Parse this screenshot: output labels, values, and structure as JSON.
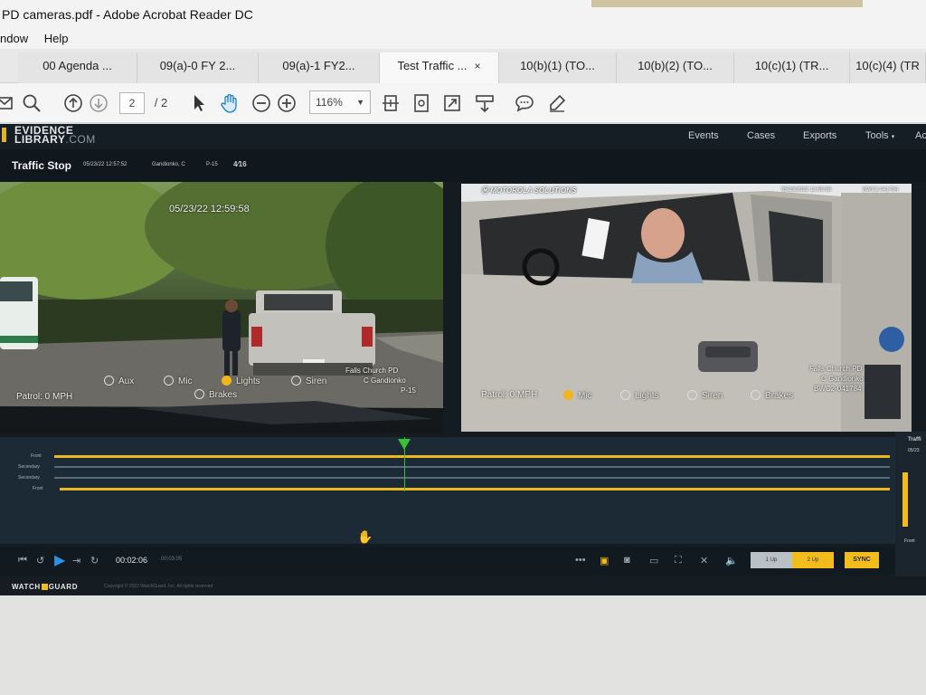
{
  "window": {
    "title": "PD cameras.pdf - Adobe Acrobat Reader DC"
  },
  "menu": {
    "items": [
      "ndow",
      "Help"
    ]
  },
  "tabs": [
    {
      "label": "00 Agenda ..."
    },
    {
      "label": "09(a)-0 FY 2..."
    },
    {
      "label": "09(a)-1 FY2..."
    },
    {
      "label": "Test Traffic ...",
      "close": "×"
    },
    {
      "label": "10(b)(1) (TO..."
    },
    {
      "label": "10(b)(2) (TO..."
    },
    {
      "label": "10(c)(1) (TR..."
    },
    {
      "label": "10(c)(4) (TR"
    }
  ],
  "toolbar": {
    "page_current": "2",
    "page_total": "/ 2",
    "zoom": "116%"
  },
  "app": {
    "logo_line1": "EVIDENCE",
    "logo_line2": "LIBRARY",
    "logo_domain": ".COM",
    "nav": [
      "Events",
      "Cases",
      "Exports",
      "Tools",
      "Ac"
    ],
    "tools_caret": "▾",
    "incident_title": "Traffic Stop",
    "incident_meta": [
      "05/23/22 12:57:52",
      "Gandionko, C",
      "P-15"
    ]
  },
  "video_left": {
    "timestamp": "05/23/22 12:59:58",
    "speed": "Patrol: 0 MPH",
    "indicators": {
      "aux": "Aux",
      "mic": "Mic",
      "lights": "Lights",
      "siren": "Siren",
      "brakes": "Brakes"
    },
    "agency": "Falls Church PD",
    "officer": "C Gandionko",
    "unit": "P-15"
  },
  "video_right": {
    "brand": "MOTOROLA SOLUTIONS",
    "timestamp": "05/23/2022 12:59:58",
    "device": "BWC2-041784",
    "speed": "Patrol: 0 MPH",
    "indicators": {
      "mic": "Mic",
      "lights": "Lights",
      "siren": "Siren",
      "brakes": "Brakes"
    },
    "agency": "Falls Church PD",
    "officer": "C Gandionko",
    "unit": "BWC2-041784"
  },
  "timeline": {
    "tracks": [
      {
        "label": "Front",
        "color": "#e8b81d"
      },
      {
        "label": "Secondary",
        "color": "#5b6d7d"
      },
      {
        "label": "Secondary",
        "color": "#5b6d7d"
      },
      {
        "label": "Front",
        "color": "#e8b81d"
      }
    ]
  },
  "player": {
    "time_current": "00:02:06",
    "time_total": "00:03:05",
    "view_1up": "1 Up",
    "view_2up": "2 Up",
    "sync": "SYNC"
  },
  "side_panel": {
    "label": "Traffi",
    "meta": "05/23",
    "footer": "Front"
  },
  "footer": {
    "brand_a": "WATCH",
    "brand_b": "GUARD",
    "copyright": "Copyright © 2022 WatchGuard, Inc. All rights reserved"
  }
}
